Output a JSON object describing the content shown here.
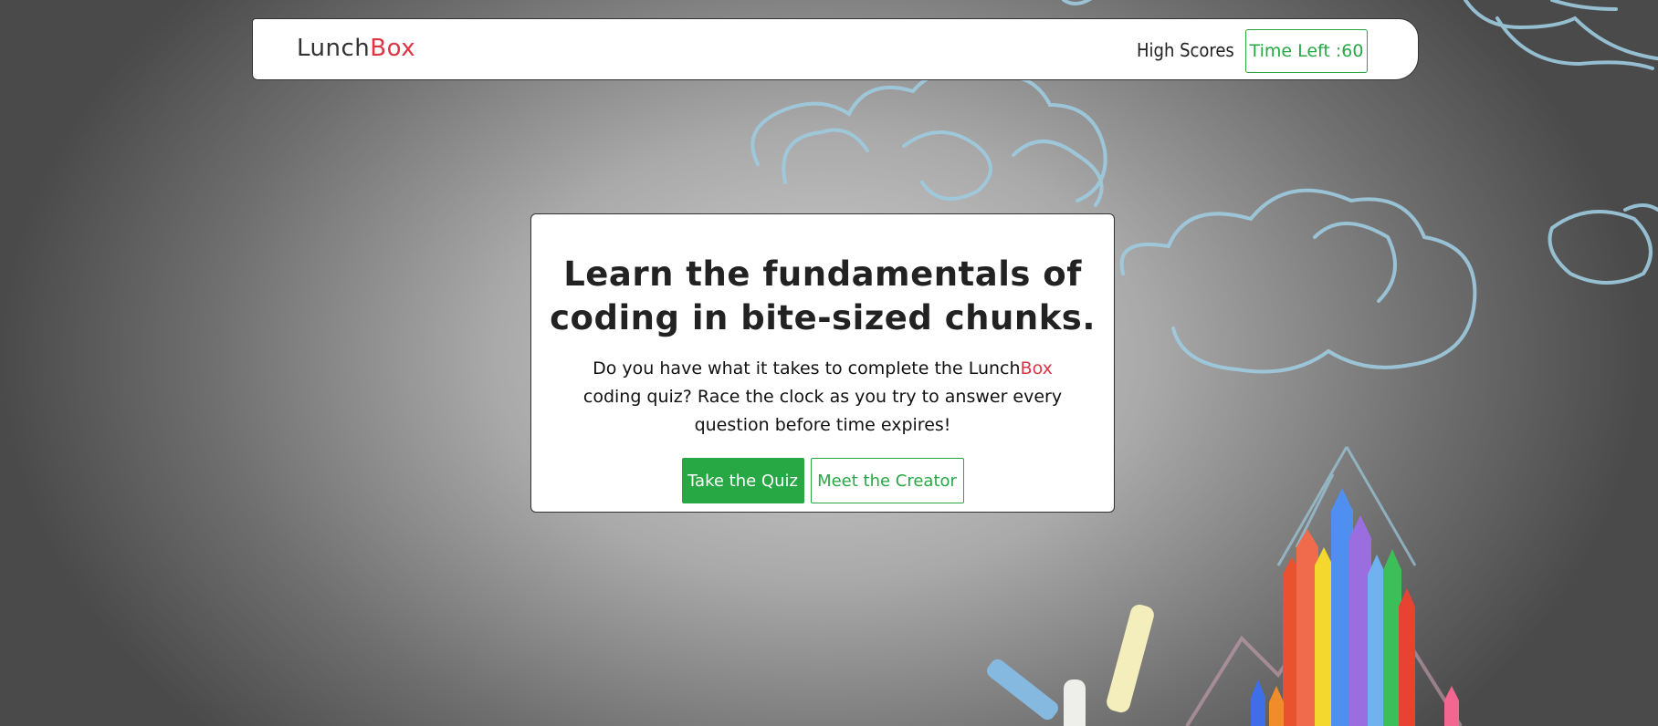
{
  "navbar": {
    "brand_part1": "Lunch",
    "brand_part2": "Box",
    "high_scores": "High Scores",
    "timer": "Time Left :60"
  },
  "hero": {
    "title_line1": "Learn the fundamentals of",
    "title_line2": "coding in bite-sized chunks.",
    "text_before": "Do you have what it takes to complete the Lunch",
    "text_accent": "Box",
    "text_after": " coding quiz? Race the clock as you try to answer every question before time expires!",
    "take_quiz": "Take the Quiz",
    "meet_creator": "Meet the Creator"
  },
  "colors": {
    "accent": "#dc3545",
    "primary": "#28a745"
  },
  "background": {
    "description_icons": [
      "chalk-cloud-icon",
      "crayons-icon",
      "chalk-stick-icon"
    ]
  }
}
